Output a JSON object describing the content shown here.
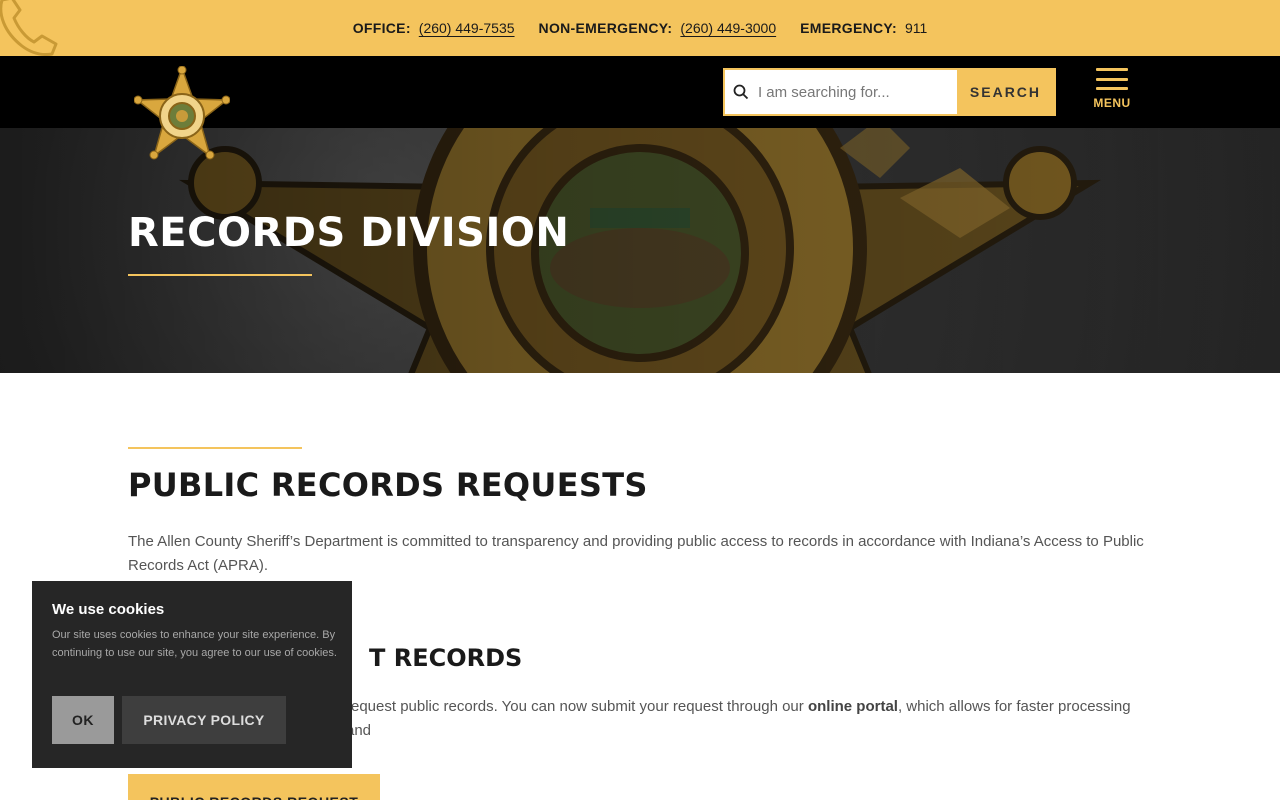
{
  "topbar": {
    "icon": "phone-icon",
    "office_label": "OFFICE:",
    "office_number": "(260) 449-7535",
    "nonemergency_label": "NON-EMERGENCY:",
    "nonemergency_number": "(260) 449-3000",
    "emergency_label": "EMERGENCY:",
    "emergency_number": "911"
  },
  "header": {
    "logo_icon": "sheriff-star-badge-icon",
    "search_placeholder": "I am searching for...",
    "search_button": "SEARCH",
    "menu_label": "MENU"
  },
  "hero": {
    "title": "RECORDS DIVISION"
  },
  "main": {
    "heading": "PUBLIC RECORDS REQUESTS",
    "intro": "The Allen County Sheriff’s Department is committed to transparency and providing public access to records in accordance with Indiana’s Access to Public Records Act (APRA).",
    "subheading_partial": "T RECORDS",
    "body_partial_before": "request public records. You can now submit your request through our ",
    "body_link": "online portal",
    "body_partial_after": ", which allows for faster processing and",
    "cta_button": "PUBLIC RECORDS REQUEST"
  },
  "cookie": {
    "title": "We use cookies",
    "body": "Our site uses cookies to enhance your site experience. By continuing to use our site, you agree to our use of cookies.",
    "ok_button": "OK",
    "privacy_button": "PRIVACY POLICY"
  },
  "colors": {
    "accent": "#f4c45d",
    "header_bg": "#000000",
    "cookie_bg": "#262626"
  }
}
